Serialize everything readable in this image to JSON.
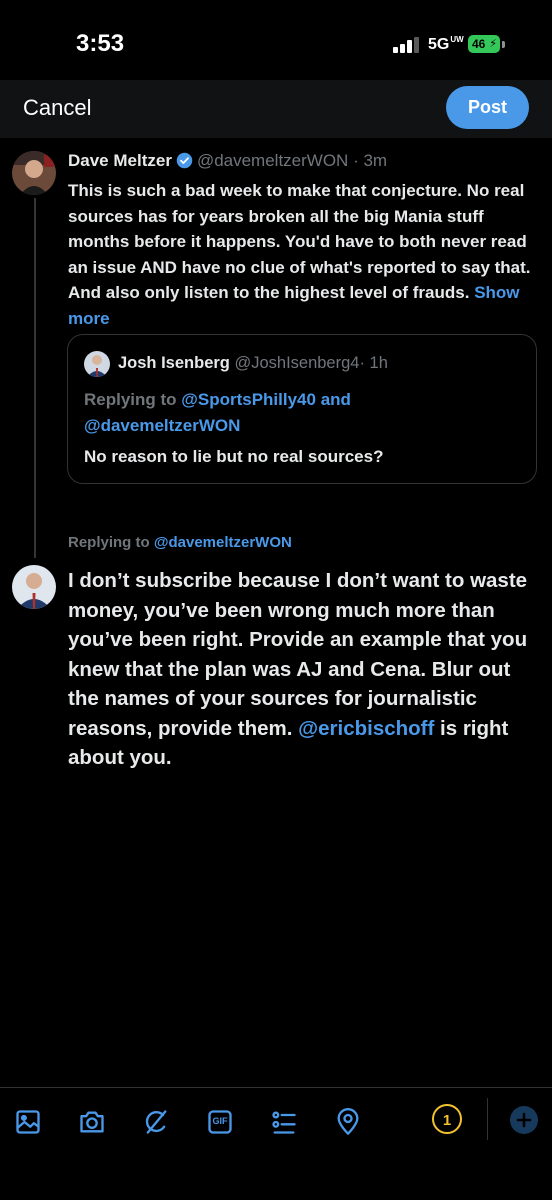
{
  "status_bar": {
    "time": "3:53",
    "network": "5G",
    "network_sub": "UW",
    "battery": "46"
  },
  "top_bar": {
    "cancel_label": "Cancel",
    "post_label": "Post"
  },
  "original_tweet": {
    "author_name": "Dave Meltzer",
    "author_handle": "@davemeltzerWON",
    "time_ago": "· 3m",
    "body": "This is such a bad week to make that conjecture. No real sources has for years broken all the big Mania stuff months before it happens.  You'd have to both never read an issue AND have no clue of what's reported to say that.  And also only listen to the highest level of frauds.",
    "show_more": "Show more",
    "quoted_tweet": {
      "author_name": "Josh Isenberg",
      "author_handle": "@JoshIsenberg4",
      "time_ago": "· 1h",
      "replying_prefix": "Replying to",
      "replying_mention_1": "@SportsPhilly40",
      "replying_and": "and",
      "replying_mention_2": "@davemeltzerWON",
      "text": "No reason to lie but no real sources?"
    }
  },
  "reply_context": {
    "prefix": "Replying to",
    "mention": "@davemeltzerWON"
  },
  "compose": {
    "text_before_mention": "I don’t subscribe because I don’t want to waste money, you’ve been wrong much more than you’ve been right. Provide an example that you knew that the plan was AJ and Cena. Blur out the names of your sources for journalistic reasons, provide them.",
    "mention": "@ericbischoff",
    "text_after_mention": "is right about you."
  },
  "toolbar": {
    "icons": [
      "image-icon",
      "camera-icon",
      "grok-icon",
      "gif-icon",
      "poll-icon",
      "location-icon"
    ],
    "gif_label": "GIF",
    "thread_count": "1"
  },
  "colors": {
    "accent": "#4a99e9",
    "background": "#000000",
    "counter": "#f2c230"
  }
}
